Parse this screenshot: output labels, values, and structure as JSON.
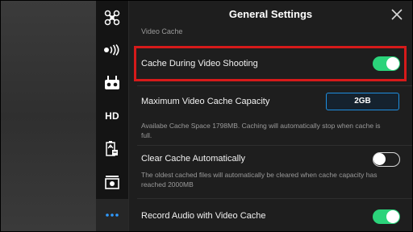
{
  "header": {
    "title": "General Settings"
  },
  "sidebar": {
    "items": [
      {
        "icon": "aircraft-icon"
      },
      {
        "icon": "signal-icon"
      },
      {
        "icon": "remote-controller-icon"
      },
      {
        "label": "HD"
      },
      {
        "icon": "battery-icon"
      },
      {
        "icon": "camera-icon"
      },
      {
        "icon": "more-icon"
      }
    ]
  },
  "section": {
    "label": "Video Cache"
  },
  "settings": {
    "cache_during_shooting": {
      "label": "Cache During Video Shooting",
      "enabled": true
    },
    "max_capacity": {
      "label": "Maximum Video Cache Capacity",
      "value": "2GB",
      "note": "Availabe Cache Space 1798MB. Caching will automatically stop when cache is full."
    },
    "clear_cache": {
      "label": "Clear Cache Automatically",
      "enabled": false,
      "note": "The oldest cached files will automatically be cleared when cache capacity has reached 2000MB"
    },
    "record_audio": {
      "label": "Record Audio with Video Cache",
      "enabled": true
    }
  },
  "colors": {
    "toggle_on": "#2bd37a",
    "highlight": "#d61a1a",
    "button_border": "#1e8fe0"
  }
}
